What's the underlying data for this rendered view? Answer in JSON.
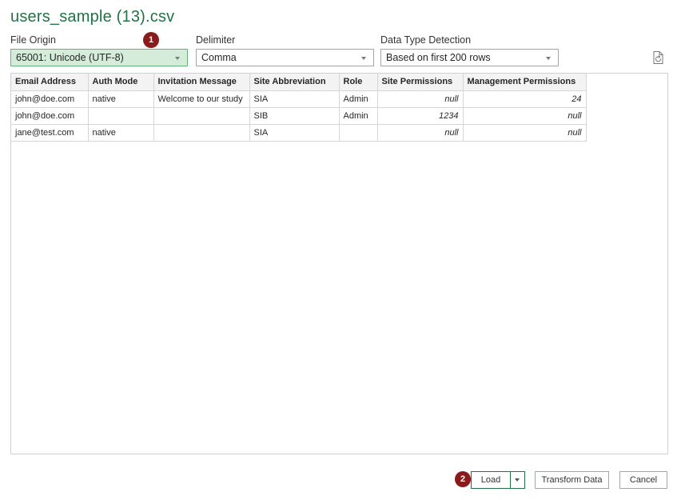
{
  "dialog": {
    "title": "users_sample (13).csv"
  },
  "file_origin": {
    "label": "File Origin",
    "value": "65001: Unicode (UTF-8)"
  },
  "delimiter": {
    "label": "Delimiter",
    "value": "Comma"
  },
  "data_type_detection": {
    "label": "Data Type Detection",
    "value": "Based on first 200 rows"
  },
  "badges": {
    "one": "1",
    "two": "2"
  },
  "table": {
    "headers": [
      "Email Address",
      "Auth Mode",
      "Invitation Message",
      "Site Abbreviation",
      "Role",
      "Site Permissions",
      "Management Permissions"
    ],
    "rows": [
      [
        "john@doe.com",
        "native",
        "Welcome to our study",
        "SIA",
        "Admin",
        "null",
        "24"
      ],
      [
        "john@doe.com",
        "",
        "",
        "SIB",
        "Admin",
        "1234",
        "null"
      ],
      [
        "jane@test.com",
        "native",
        "",
        "SIA",
        "",
        "null",
        "null"
      ]
    ]
  },
  "buttons": {
    "load": "Load",
    "transform": "Transform Data",
    "cancel": "Cancel"
  },
  "icons": {
    "refresh": "refresh-document-icon",
    "dropdown": "chevron-down-icon"
  },
  "colors": {
    "accent": "#217346",
    "badge": "#8b1a1a",
    "selected_field": "#d4ecd9"
  }
}
